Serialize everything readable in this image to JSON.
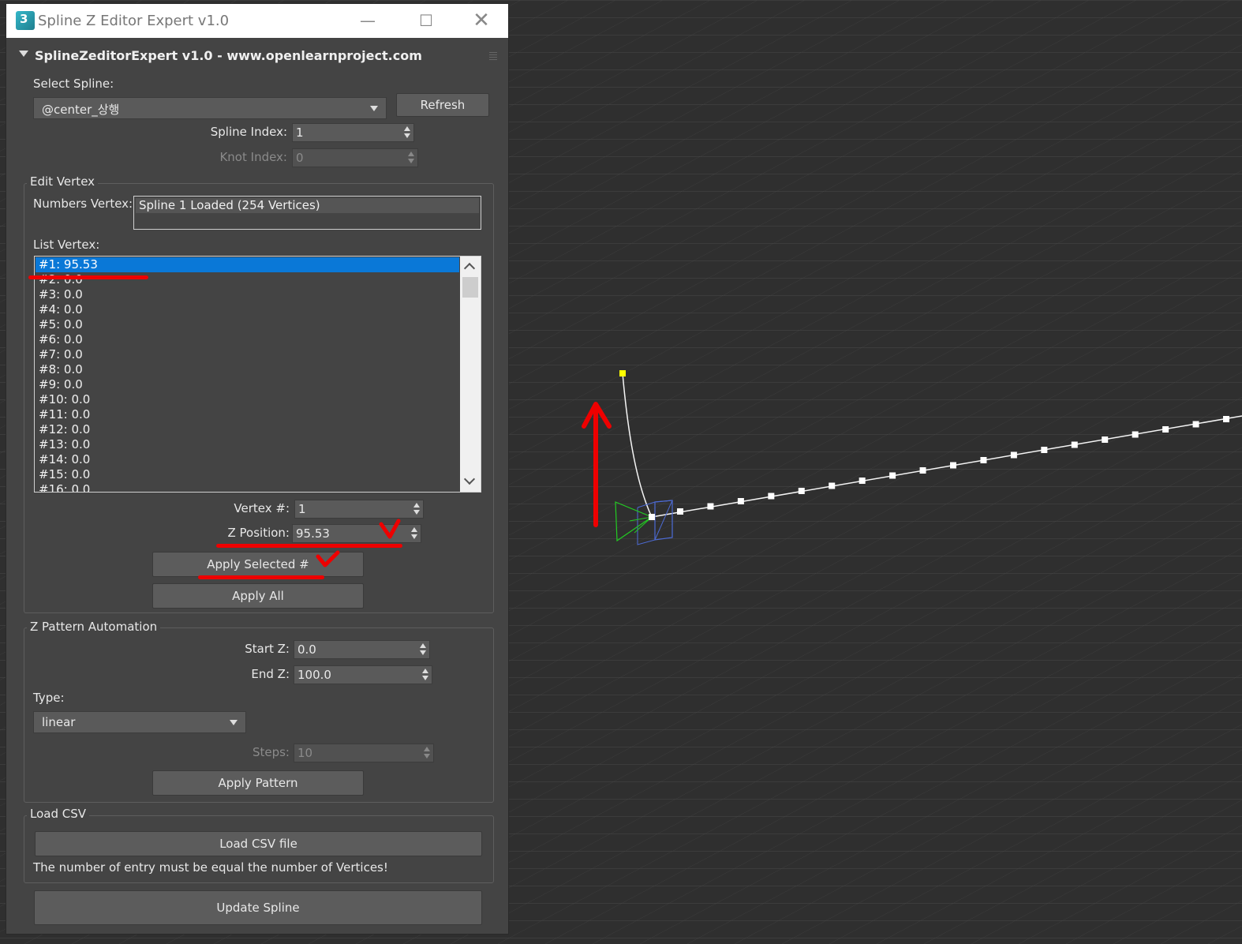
{
  "window": {
    "title": "Spline Z Editor Expert v1.0",
    "icon_label": "3"
  },
  "rollout": {
    "title": "SplineZeditorExpert v1.0 - www.openlearnproject.com"
  },
  "select_spline": {
    "label": "Select Spline:",
    "value": "@center_상행",
    "refresh": "Refresh",
    "spline_index_label": "Spline Index:",
    "spline_index_value": "1",
    "knot_index_label": "Knot Index:",
    "knot_index_value": "0"
  },
  "edit_vertex": {
    "group_title": "Edit Vertex",
    "numbers_label": "Numbers Vertex:",
    "numbers_value": "Spline 1 Loaded (254 Vertices)",
    "list_label": "List Vertex:",
    "list": [
      "#1: 95.53",
      "#2: 0.0",
      "#3: 0.0",
      "#4: 0.0",
      "#5: 0.0",
      "#6: 0.0",
      "#7: 0.0",
      "#8: 0.0",
      "#9: 0.0",
      "#10: 0.0",
      "#11: 0.0",
      "#12: 0.0",
      "#13: 0.0",
      "#14: 0.0",
      "#15: 0.0",
      "#16: 0.0"
    ],
    "vertex_label": "Vertex #:",
    "vertex_value": "1",
    "zpos_label": "Z Position:",
    "zpos_value": "95.53",
    "apply_selected": "Apply Selected #",
    "apply_all": "Apply All"
  },
  "pattern": {
    "group_title": "Z Pattern Automation",
    "start_label": "Start Z:",
    "start_value": "0.0",
    "end_label": "End Z:",
    "end_value": "100.0",
    "type_label": "Type:",
    "type_value": "linear",
    "steps_label": "Steps:",
    "steps_value": "10",
    "apply_pattern": "Apply Pattern"
  },
  "csv": {
    "group_title": "Load CSV",
    "load_button": "Load CSV file",
    "note": "The number of entry must be equal the number of Vertices!"
  },
  "update_button": "Update Spline",
  "colors": {
    "viewport_bg": "#2f2f2f",
    "panel_bg": "#444444",
    "selection": "#0a78d7",
    "annotation_red": "#ee0000",
    "vertex_yellow": "#ffff00"
  }
}
